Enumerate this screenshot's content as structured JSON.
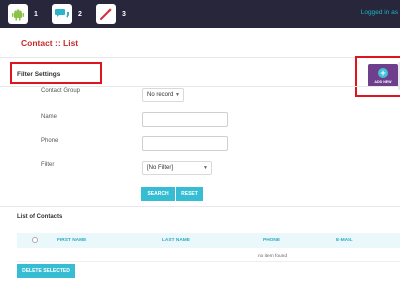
{
  "topbar": {
    "notifications": [
      {
        "icon": "android-icon",
        "count": "1",
        "color": "#8bc34a"
      },
      {
        "icon": "chat-bubbles-icon",
        "count": "2",
        "color": "#2bb5c9"
      },
      {
        "icon": "magic-wand-icon",
        "count": "3",
        "color": "#d62f3a"
      }
    ],
    "logged_in_text": "Logged in as"
  },
  "page": {
    "title": "Contact :: List"
  },
  "filter": {
    "title": "Filter Settings",
    "add_button_label": "ADD NEW",
    "fields": {
      "contact_group": {
        "label": "Contact Group",
        "value": "No record"
      },
      "name": {
        "label": "Name",
        "value": ""
      },
      "phone": {
        "label": "Phone",
        "value": ""
      },
      "filter": {
        "label": "Filter",
        "value": "[No Filter]"
      }
    },
    "search_label": "SEARCH",
    "reset_label": "RESET"
  },
  "list": {
    "title": "List of Contacts",
    "columns": [
      "FIRST NAME",
      "LAST NAME",
      "PHONE",
      "E-MAIL"
    ],
    "empty_text": "no item found",
    "delete_label": "DELETE SELECTED"
  },
  "colors": {
    "topbar": "#27263a",
    "title_red": "#c82a2a",
    "accent_cyan": "#37bdd3",
    "add_purple": "#6e3f8c",
    "highlight_red": "#e0141e"
  }
}
